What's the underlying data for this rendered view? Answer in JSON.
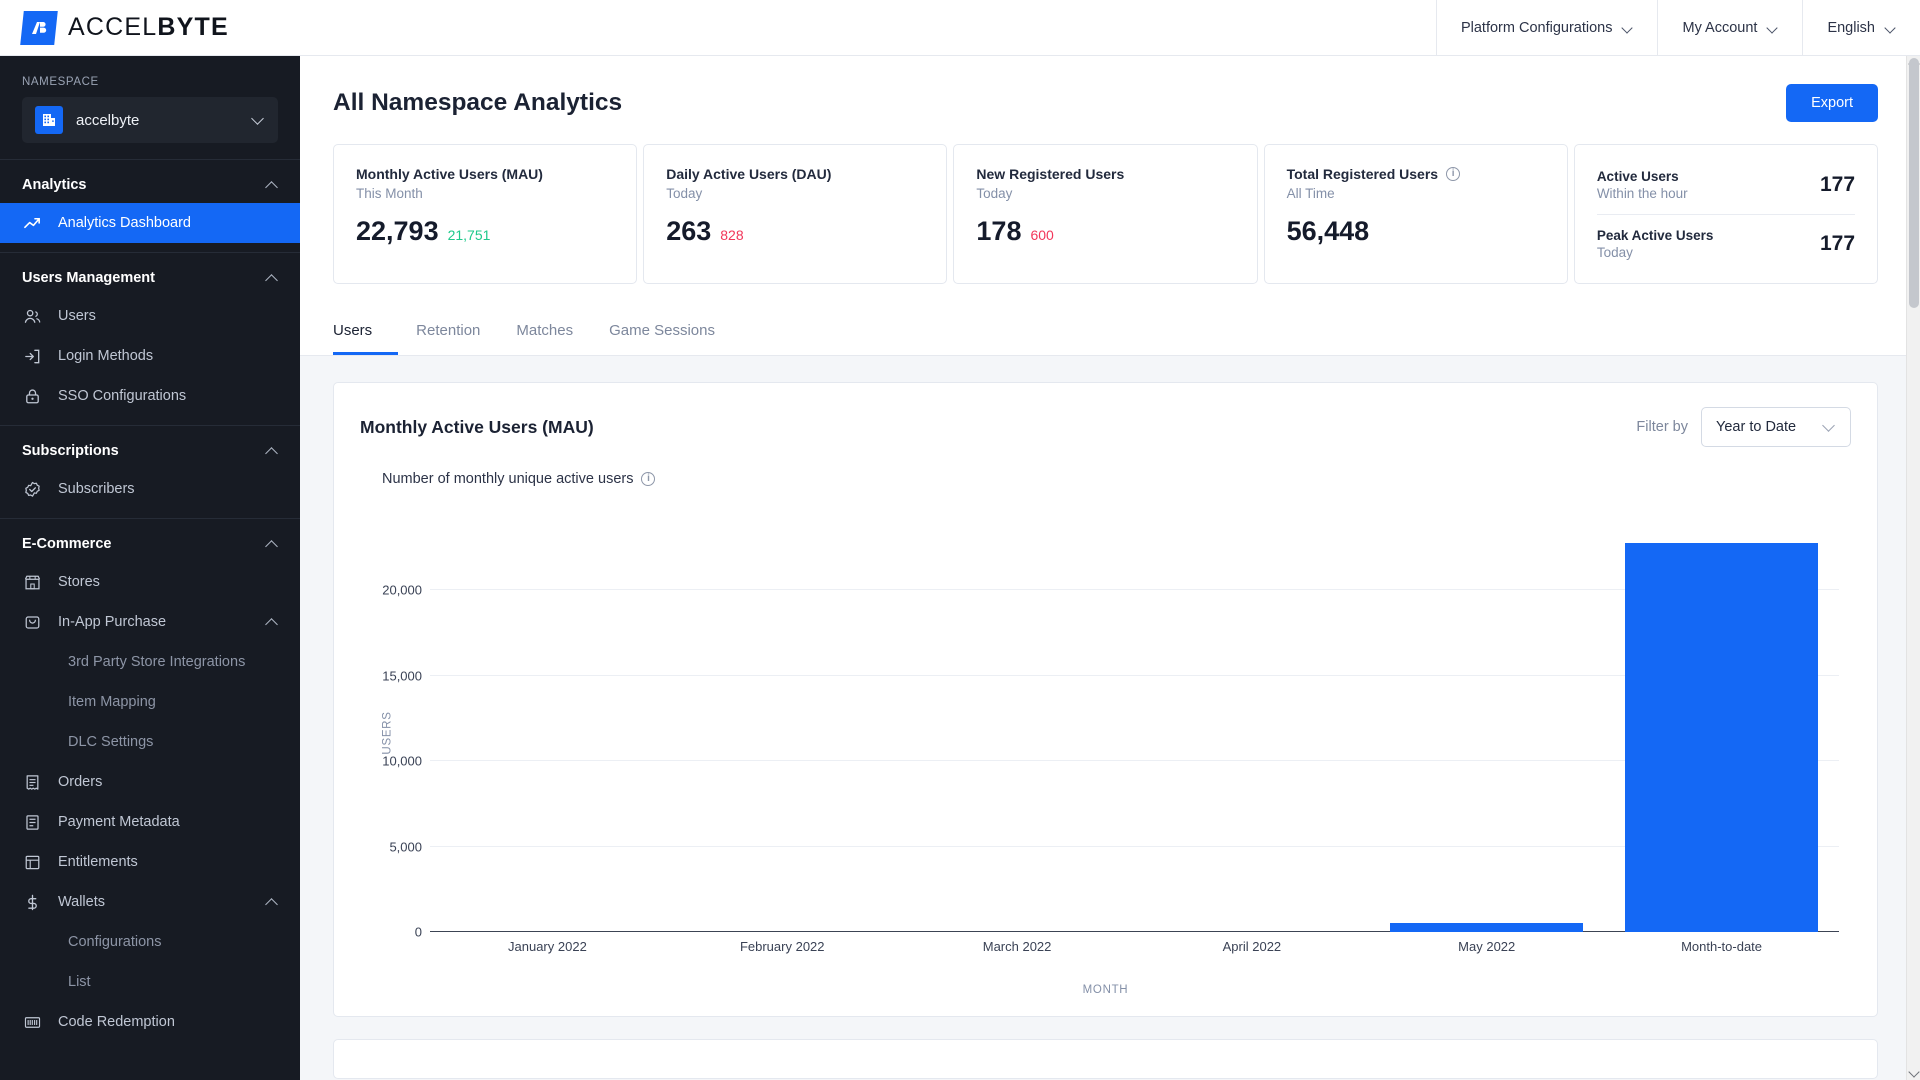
{
  "brand": {
    "name_light": "ACCEL",
    "name_bold": "BYTE",
    "logo_icon": "accelbyte-logo-icon"
  },
  "topnav": [
    {
      "label": "Platform Configurations",
      "icon": "chevron-down-icon"
    },
    {
      "label": "My Account",
      "icon": "chevron-down-icon"
    },
    {
      "label": "English",
      "icon": "chevron-down-icon"
    }
  ],
  "sidebar": {
    "namespace_label": "NAMESPACE",
    "namespace_value": "accelbyte",
    "namespace_icon": "building-icon",
    "groups": [
      {
        "title": "Analytics",
        "collapse_icon": "chevron-up-icon",
        "items": [
          {
            "label": "Analytics Dashboard",
            "icon": "trending-up-icon",
            "active": true
          }
        ]
      },
      {
        "title": "Users Management",
        "collapse_icon": "chevron-up-icon",
        "items": [
          {
            "label": "Users",
            "icon": "users-icon",
            "active": false
          },
          {
            "label": "Login Methods",
            "icon": "login-icon",
            "active": false
          },
          {
            "label": "SSO Configurations",
            "icon": "lock-icon",
            "active": false
          }
        ]
      },
      {
        "title": "Subscriptions",
        "collapse_icon": "chevron-up-icon",
        "items": [
          {
            "label": "Subscribers",
            "icon": "badge-check-icon",
            "active": false
          }
        ]
      },
      {
        "title": "E-Commerce",
        "collapse_icon": "chevron-up-icon",
        "items": [
          {
            "label": "Stores",
            "icon": "store-icon",
            "active": false
          },
          {
            "label": "In-App Purchase",
            "icon": "bag-icon",
            "active": false,
            "expand_icon": "chevron-up-icon",
            "children": [
              {
                "label": "3rd Party Store Integrations"
              },
              {
                "label": "Item Mapping"
              },
              {
                "label": "DLC Settings"
              }
            ]
          },
          {
            "label": "Orders",
            "icon": "receipt-icon",
            "active": false
          },
          {
            "label": "Payment Metadata",
            "icon": "document-icon",
            "active": false
          },
          {
            "label": "Entitlements",
            "icon": "list-icon",
            "active": false
          },
          {
            "label": "Wallets",
            "icon": "dollar-icon",
            "active": false,
            "expand_icon": "chevron-up-icon",
            "children": [
              {
                "label": "Configurations"
              },
              {
                "label": "List"
              }
            ]
          },
          {
            "label": "Code Redemption",
            "icon": "barcode-icon",
            "active": false
          }
        ]
      }
    ]
  },
  "page": {
    "title": "All Namespace Analytics",
    "export_label": "Export"
  },
  "stats": [
    {
      "title": "Monthly Active Users (MAU)",
      "subtitle": "This Month",
      "value": "22,793",
      "delta": "21,751",
      "delta_dir": "up"
    },
    {
      "title": "Daily Active Users (DAU)",
      "subtitle": "Today",
      "value": "263",
      "delta": "828",
      "delta_dir": "down"
    },
    {
      "title": "New Registered Users",
      "subtitle": "Today",
      "value": "178",
      "delta": "600",
      "delta_dir": "down"
    },
    {
      "title": "Total Registered Users",
      "subtitle": "All Time",
      "value": "56,448",
      "delta": "",
      "delta_dir": "",
      "info_icon": "info-icon"
    }
  ],
  "mini_stats": [
    {
      "label": "Active Users",
      "subtitle": "Within the hour",
      "value": "177"
    },
    {
      "label": "Peak Active Users",
      "subtitle": "Today",
      "value": "177"
    }
  ],
  "tabs": [
    {
      "label": "Users",
      "active": true
    },
    {
      "label": "Retention",
      "active": false
    },
    {
      "label": "Matches",
      "active": false
    },
    {
      "label": "Game Sessions",
      "active": false
    }
  ],
  "chart_card": {
    "title": "Monthly Active Users (MAU)",
    "filter_label": "Filter by",
    "filter_value": "Year to Date",
    "filter_icon": "chevron-down-icon",
    "subtitle": "Number of monthly unique active users",
    "subtitle_icon": "info-icon"
  },
  "colors": {
    "accent": "#1468f5",
    "sidebar_bg": "#171b23",
    "positive": "#1ec98b",
    "negative": "#f2365a",
    "bar": "#1468f5"
  },
  "chart_data": {
    "type": "bar",
    "title": "Monthly Active Users (MAU)",
    "subtitle": "Number of monthly unique active users",
    "xlabel": "MONTH",
    "ylabel": "USERS",
    "categories": [
      "January 2022",
      "February 2022",
      "March 2022",
      "April 2022",
      "May 2022",
      "Month-to-date"
    ],
    "values": [
      0,
      0,
      0,
      0,
      500,
      22793
    ],
    "ylim": [
      0,
      25000
    ],
    "yticks": [
      0,
      5000,
      10000,
      15000,
      20000
    ],
    "ytick_labels": [
      "0",
      "5,000",
      "10,000",
      "15,000",
      "20,000"
    ],
    "grid": true,
    "legend": "none",
    "series_color": "#1468f5"
  }
}
